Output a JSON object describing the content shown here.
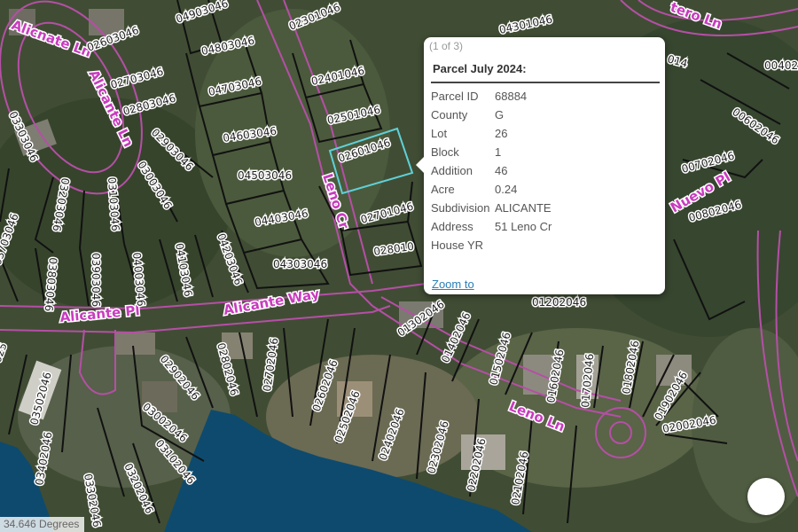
{
  "streets": [
    "Alicnate Ln",
    "Alicante Ln",
    "Leno Cr",
    "Alicante Way",
    "Alicante Pl",
    "Leno Ln",
    "Nuevo Pl",
    "tero Ln"
  ],
  "lot_labels": [
    "02601046",
    "02501046",
    "02401046",
    "02301046",
    "02701046",
    "028010",
    "04503046",
    "04403046",
    "04303046",
    "04603046",
    "04703046",
    "04803046",
    "04903046",
    "02603046",
    "02703046",
    "02803046",
    "02903046",
    "03003046",
    "03103046",
    "03203046",
    "03303046",
    "04103046",
    "04203046",
    "04003046",
    "03903046",
    "03803046",
    "03703046",
    "01302046",
    "01402046",
    "01502046",
    "01602046",
    "01702046",
    "01802046",
    "01902046",
    "02002046",
    "01202046",
    "00802046",
    "00702046",
    "00602046",
    "00402",
    "014",
    "04301046",
    "02902046",
    "02802046",
    "02702046",
    "02602046",
    "02502046",
    "02402046",
    "02302046",
    "02202046",
    "02102046",
    "03002046",
    "03102046",
    "03202046",
    "03302046",
    "03402046",
    "03502046",
    "025"
  ],
  "popup": {
    "pager": "(1 of 3)",
    "title": "Parcel July 2024:",
    "fields": [
      {
        "label": "Parcel ID",
        "value": "68884"
      },
      {
        "label": "County",
        "value": "G"
      },
      {
        "label": "Lot",
        "value": "26"
      },
      {
        "label": "Block",
        "value": "1"
      },
      {
        "label": "Addition",
        "value": "46"
      },
      {
        "label": "Acre",
        "value": "0.24"
      },
      {
        "label": "Subdivision",
        "value": "ALICANTE"
      },
      {
        "label": "Address",
        "value": "51 Leno Cr"
      },
      {
        "label": "House YR",
        "value": ""
      }
    ],
    "zoom_label": "Zoom to"
  },
  "rotation_readout": "34.646 Degrees",
  "colors": {
    "street_label": "#c93bbf",
    "parcel_line": "#111111",
    "selected_parcel": "#5fd0d8",
    "water": "#0e4a6e",
    "road_outline": "#b54fa6"
  }
}
